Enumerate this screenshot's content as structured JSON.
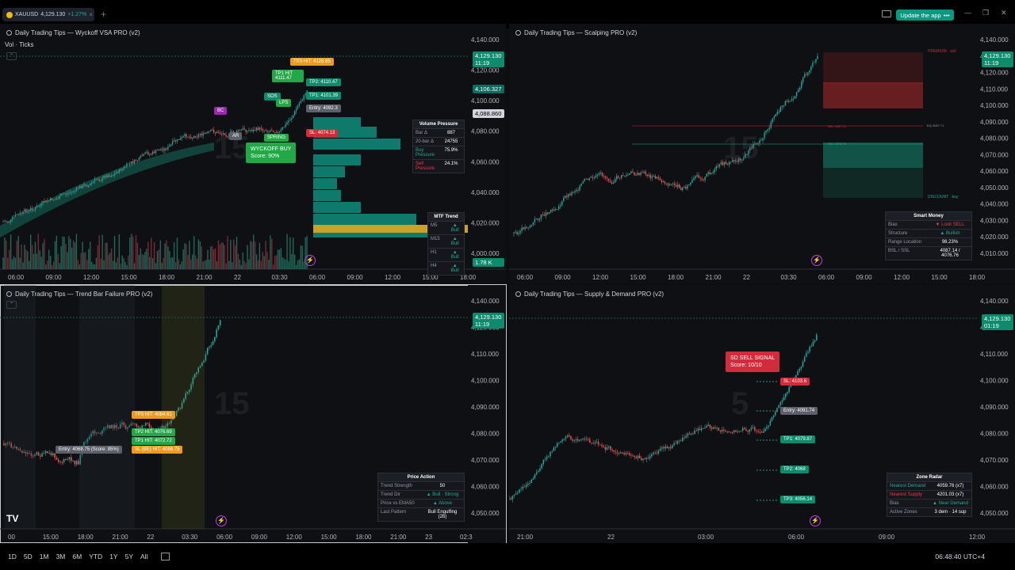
{
  "symbol_tab": {
    "symbol": "XAUUSD",
    "price": "4,129.130",
    "change": "+1.27%"
  },
  "update_button": "Update the app",
  "panes": [
    {
      "title": "Daily Trading Tips — Wyckoff VSA PRO (v2)",
      "sublabel": "Vol · Ticks",
      "price_axis": [
        "4,140.000",
        "4,120.000",
        "4,100.000",
        "4,080.000",
        "4,060.000",
        "4,040.000",
        "4,020.000",
        "4,000.000"
      ],
      "time_axis": [
        "06:00",
        "09:00",
        "12:00",
        "15:00",
        "18:00",
        "21:00",
        "22",
        "03:30",
        "06:00",
        "09:00",
        "12:00",
        "15:00",
        "18:00"
      ],
      "last_price": "4,129.130",
      "countdown": "11:19",
      "label2": "4,106.327",
      "label3": "4,088.860",
      "volume_label": "1.78 K",
      "chips": [
        "TP3 HIT: 4128.65",
        "TP1 HIT 4111.47",
        "TP2: 4110.47",
        "TP1: 4101.39",
        "Entry: 4092.3",
        "SL: 4074.13",
        "BC",
        "AR",
        "SPRING",
        "SOS",
        "LPS"
      ],
      "signal": {
        "text": "WYCKOFF BUY",
        "score": "Score: 90%"
      },
      "volume_pressure": {
        "title": "Volume Pressure",
        "rows": [
          [
            "Bar Δ",
            "887"
          ],
          [
            "20-bar Δ",
            "24755"
          ],
          [
            "Buy Pressure",
            "75.9%"
          ],
          [
            "Sell Pressure",
            "24.1%"
          ]
        ]
      },
      "mtf": {
        "title": "MTF Trend",
        "rows": [
          [
            "M5",
            "▲ Bull"
          ],
          [
            "M15",
            "▲ Bull"
          ],
          [
            "H1",
            "▲ Bull"
          ],
          [
            "H4",
            "▲ Bull"
          ]
        ]
      }
    },
    {
      "title": "Daily Trading Tips — Scalping PRO (v2)",
      "price_axis": [
        "4,140.000",
        "4,130.000",
        "4,120.000",
        "4,110.000",
        "4,100.000",
        "4,090.000",
        "4,080.000",
        "4,070.000",
        "4,060.000",
        "4,050.000",
        "4,040.000",
        "4,030.000",
        "4,020.000",
        "4,010.000"
      ],
      "time_axis": [
        "06:00",
        "09:00",
        "12:00",
        "15:00",
        "18:00",
        "21:00",
        "22",
        "03:30",
        "06:00",
        "09:00",
        "12:00",
        "15:00",
        "18:00"
      ],
      "last_price": "4,129.130",
      "countdown": "11:19",
      "premium": "PREMIUM · sell",
      "discount": "DISCOUNT · buy",
      "eq": "EQ 4087.71",
      "bsl": "BSL 4087.14",
      "ssl": "SSL 4076.76",
      "smart_money": {
        "title": "Smart Money",
        "rows": [
          [
            "Bias",
            "▼ Look SELL"
          ],
          [
            "Structure",
            "▲ Bullish"
          ],
          [
            "Range Location",
            "98.23%"
          ],
          [
            "BSL / SSL",
            "4087.14 / 4076.76"
          ]
        ]
      }
    },
    {
      "title": "Daily Trading Tips — Trend Bar Failure PRO (v2)",
      "price_axis": [
        "4,140.000",
        "4,120.000",
        "4,110.000",
        "4,100.000",
        "4,090.000",
        "4,080.000",
        "4,070.000",
        "4,060.000",
        "4,050.000"
      ],
      "time_axis": [
        "00",
        "15:00",
        "18:00",
        "21:00",
        "22",
        "03:30",
        "06:00",
        "09:00",
        "12:00",
        "15:00",
        "18:00",
        "21:00",
        "23",
        "02:3"
      ],
      "last_price": "4,129.130",
      "countdown": "11:19",
      "chips": [
        "TP3 HIT: 4084.61",
        "TP2 HIT: 4076.69",
        "TP1 HIT: 4072.72",
        "SL (BE) HIT: 4068.75",
        "Entry: 4068.75 (Score: 85%)"
      ],
      "price_action": {
        "title": "Price Action",
        "rows": [
          [
            "Trend Strength",
            "50"
          ],
          [
            "Trend Dir",
            "▲ Bull · Strong"
          ],
          [
            "Price vs EMA50",
            "▲ Above"
          ],
          [
            "Last Pattern",
            "Bull Engulfing (2b)"
          ]
        ]
      }
    },
    {
      "title": "Daily Trading Tips — Supply & Demand PRO (v2)",
      "price_axis": [
        "4,140.000",
        "4,120.000",
        "4,110.000",
        "4,100.000",
        "4,090.000",
        "4,080.000",
        "4,070.000",
        "4,060.000",
        "4,050.000"
      ],
      "time_axis": [
        "21:00",
        "22",
        "03:00",
        "06:00",
        "09:00",
        "12:00"
      ],
      "last_price": "4,129.130",
      "countdown": "01:19",
      "signal": {
        "text": "SD SELL SIGNAL",
        "score": "Score: 10/10"
      },
      "chips": [
        "SL: 4103.6",
        "Entry: 4091.74",
        "TP1: 4079.87",
        "TP2: 4068",
        "TP3: 4056.14"
      ],
      "zone_radar": {
        "title": "Zone Radar",
        "rows": [
          [
            "Nearest Demand",
            "4059.76 (x7)"
          ],
          [
            "Nearest Supply",
            "4201.03 (x7)"
          ],
          [
            "Bias",
            "▲ Near Demand"
          ],
          [
            "Active Zones",
            "3 dem · 14 sup"
          ]
        ]
      }
    }
  ],
  "bottom_ranges": [
    "1D",
    "5D",
    "1M",
    "3M",
    "6M",
    "YTD",
    "1Y",
    "5Y",
    "All"
  ],
  "clock": "06:48:40 UTC+4"
}
